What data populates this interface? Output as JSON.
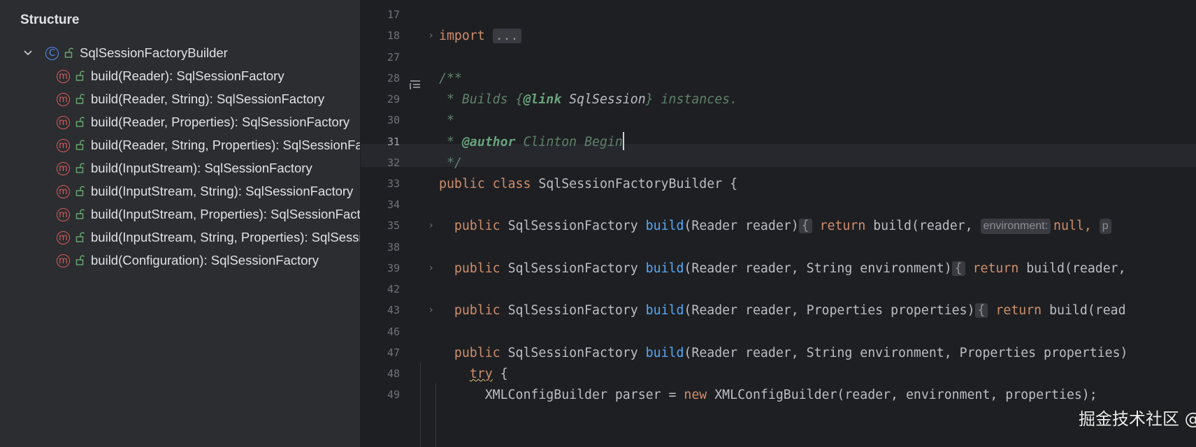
{
  "structure_panel": {
    "title": "Structure",
    "root": {
      "badge": "C",
      "label": "SqlSessionFactoryBuilder",
      "icon": "class-icon"
    },
    "methods": [
      {
        "badge": "m",
        "label": "build(Reader): SqlSessionFactory"
      },
      {
        "badge": "m",
        "label": "build(Reader, String): SqlSessionFactory"
      },
      {
        "badge": "m",
        "label": "build(Reader, Properties): SqlSessionFactory"
      },
      {
        "badge": "m",
        "label": "build(Reader, String, Properties): SqlSessionFactory"
      },
      {
        "badge": "m",
        "label": "build(InputStream): SqlSessionFactory"
      },
      {
        "badge": "m",
        "label": "build(InputStream, String): SqlSessionFactory"
      },
      {
        "badge": "m",
        "label": "build(InputStream, Properties): SqlSessionFactory"
      },
      {
        "badge": "m",
        "label": "build(InputStream, String, Properties): SqlSessionFactory"
      },
      {
        "badge": "m",
        "label": "build(Configuration): SqlSessionFactory"
      }
    ]
  },
  "editor": {
    "line_numbers": [
      "17",
      "18",
      "27",
      "28",
      "29",
      "30",
      "31",
      "32",
      "33",
      "34",
      "35",
      "38",
      "39",
      "42",
      "43",
      "46",
      "47",
      "48",
      "49"
    ],
    "current_line": "31",
    "code": {
      "import_kw": "import",
      "import_fold": "...",
      "doc_open": "/**",
      "doc_line1_a": " * Builds {",
      "doc_line1_link": "@link",
      "doc_line1_ref": "SqlSession",
      "doc_line1_b": "} instances.",
      "doc_star": " *",
      "doc_author_prefix": " * ",
      "doc_author_tag": "@author",
      "doc_author_name": " Clinton Begin",
      "doc_close": " */",
      "class_decl_kw": "public class ",
      "class_decl_name": "SqlSessionFactoryBuilder {",
      "m35": {
        "mods": "  public ",
        "type": "SqlSessionFactory ",
        "name": "build",
        "params": "(Reader reader)",
        "brace": "{",
        "ret": " return ",
        "call": "build(reader, ",
        "hint": "environment:",
        "after": "null, ",
        "hint2": "p"
      },
      "m39": {
        "mods": "  public ",
        "type": "SqlSessionFactory ",
        "name": "build",
        "params": "(Reader reader, String environment)",
        "brace": "{",
        "ret": " return ",
        "call": "build(reader,"
      },
      "m43": {
        "mods": "  public ",
        "type": "SqlSessionFactory ",
        "name": "build",
        "params": "(Reader reader, Properties properties)",
        "brace": "{",
        "ret": " return ",
        "call": "build(read"
      },
      "m47": {
        "mods": "  public ",
        "type": "SqlSessionFactory ",
        "name": "build",
        "params": "(Reader reader, String environment, Properties properties)"
      },
      "try_kw": "try",
      "try_brace": " {",
      "l49_a": "XMLConfigBuilder parser = ",
      "l49_new": "new",
      "l49_b": " XMLConfigBuilder(reader, environment, properties);"
    }
  },
  "watermark": "掘金技术社区 @ wmze",
  "colors": {
    "panel_bg": "#2b2d30",
    "editor_bg": "#1e1f22",
    "keyword": "#cf8e6d",
    "method_name": "#56a8f5",
    "doc_comment": "#5f826b",
    "class_badge": "#548af7",
    "method_badge": "#db5c5c"
  }
}
